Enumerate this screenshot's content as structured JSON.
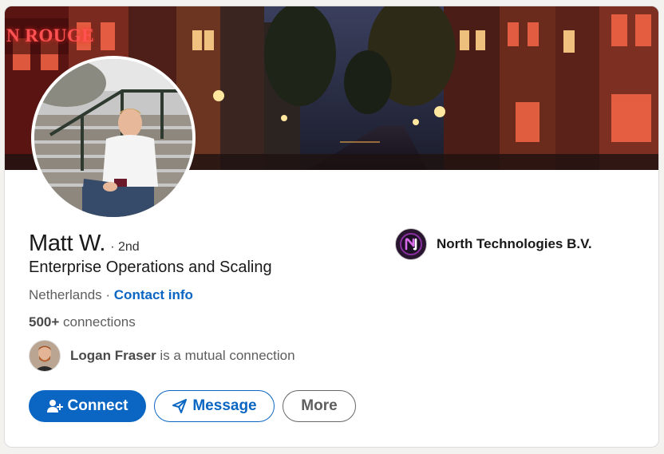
{
  "cover": {
    "sign_text": "N ROUGE"
  },
  "profile": {
    "name": "Matt W.",
    "degree": "· 2nd",
    "headline": "Enterprise Operations and Scaling",
    "location": "Netherlands",
    "separator": " · ",
    "contact_info_label": "Contact info",
    "connections_count": "500+",
    "connections_label": " connections"
  },
  "mutual": {
    "name": "Logan Fraser",
    "text": " is a mutual connection"
  },
  "company": {
    "name": "North Technologies B.V.",
    "logo_icon": "north-technologies-logo"
  },
  "actions": {
    "connect_label": "Connect",
    "connect_icon": "add-person-icon",
    "message_label": "Message",
    "message_icon": "send-icon",
    "more_label": "More"
  },
  "colors": {
    "accent": "#0a66c2",
    "card_bg": "#ffffff",
    "page_bg": "#f3f2ef"
  }
}
